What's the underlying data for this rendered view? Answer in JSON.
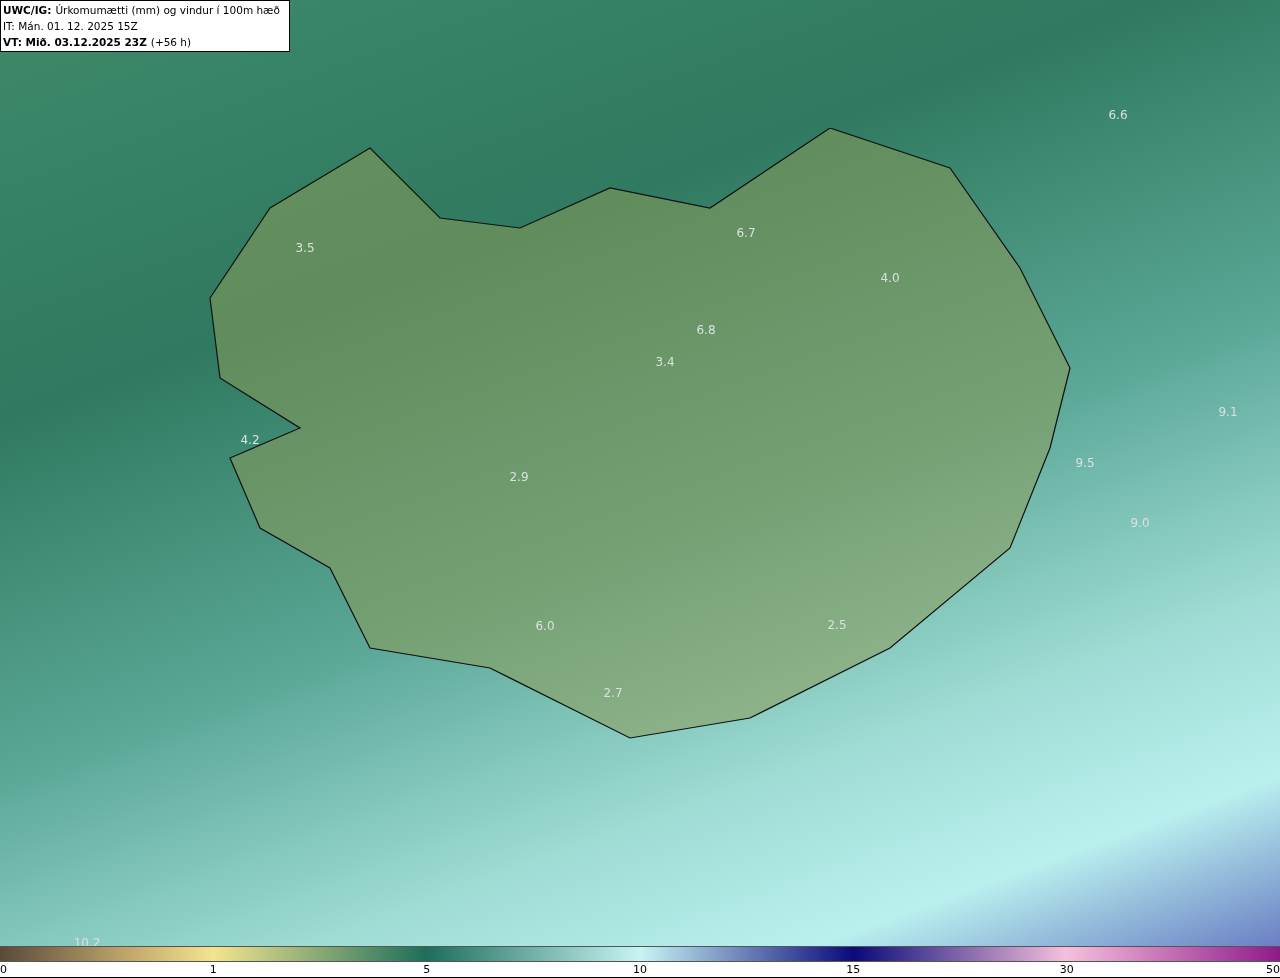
{
  "header": {
    "title_bold": "UWC/IG:",
    "title": "Úrkomumætti (mm) og vindur í 100m hæð",
    "issue_time": "IT: Mán. 01. 12. 2025 15Z",
    "valid_time_bold": "VT: Mið. 03.12.2025 23Z",
    "valid_offset": "(+56 h)"
  },
  "map_labels": [
    "6.6",
    "6.7",
    "3.5",
    "4.0",
    "6.8",
    "3.4",
    "9.1",
    "4.2",
    "9.5",
    "2.9",
    "9.0",
    "6.0",
    "2.5",
    "2.7",
    "10.2"
  ],
  "colorbar": {
    "ticks": [
      "0",
      "1",
      "5",
      "10",
      "15",
      "30",
      "50"
    ]
  }
}
